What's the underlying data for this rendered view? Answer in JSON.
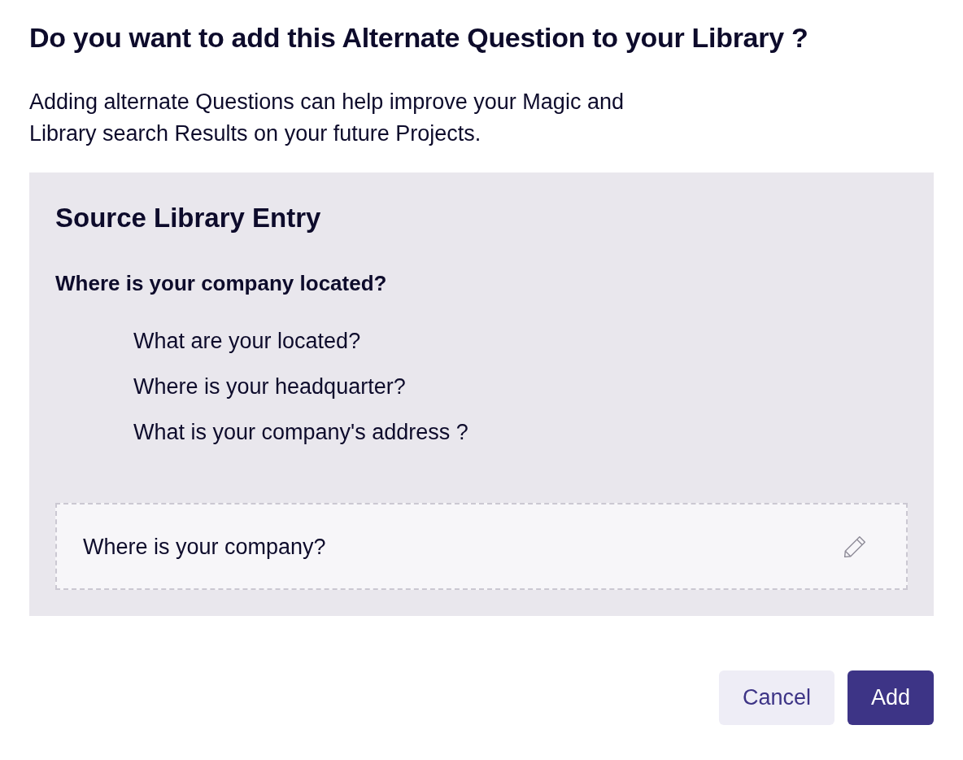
{
  "dialog": {
    "title": "Do you want to add this Alternate Question to your Library ?",
    "description": "Adding alternate Questions can help improve your Magic and Library search Results on your future Projects.",
    "source_entry": {
      "heading": "Source Library Entry",
      "question": "Where is your company located?",
      "alternates": [
        "What are your located?",
        "Where is your headquarter?",
        "What is your company's address ?"
      ]
    },
    "new_alternate": {
      "text": "Where is your company?"
    },
    "buttons": [
      {
        "label": "Cancel",
        "kind": "secondary"
      },
      {
        "label": "Add",
        "kind": "primary"
      }
    ]
  }
}
